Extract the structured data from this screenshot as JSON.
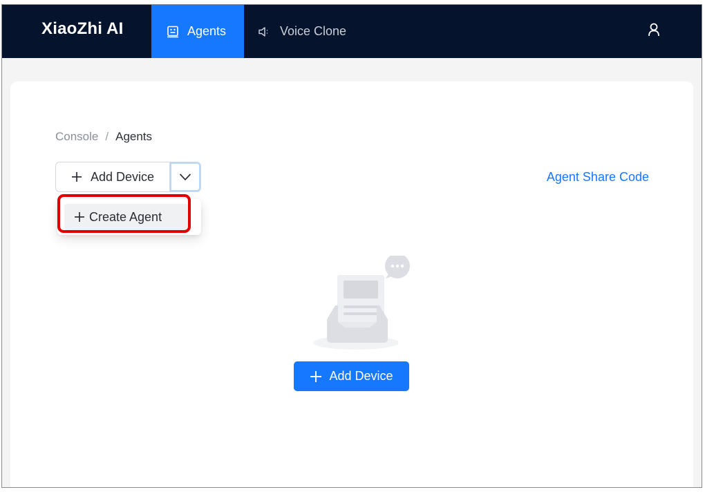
{
  "header": {
    "brand": "XiaoZhi AI",
    "tabs": [
      {
        "label": "Agents",
        "icon": "robot-icon",
        "active": true
      },
      {
        "label": "Voice Clone",
        "icon": "speaker-icon",
        "active": false
      }
    ],
    "user_icon": "user-icon"
  },
  "breadcrumb": {
    "root": "Console",
    "separator": "/",
    "current": "Agents"
  },
  "toolbar": {
    "add_device_label": "Add Device",
    "dropdown_arrow_icon": "chevron-down-icon",
    "share_code_label": "Agent Share Code"
  },
  "dropdown_menu": {
    "items": [
      {
        "label": "Create Agent",
        "icon": "plus-icon",
        "highlighted": true
      }
    ]
  },
  "empty_state": {
    "illustration": "empty-inbox-icon",
    "button_label": "Add Device"
  },
  "colors": {
    "header_bg": "#06132c",
    "accent": "#1677ff",
    "highlight_border": "#e00000"
  }
}
